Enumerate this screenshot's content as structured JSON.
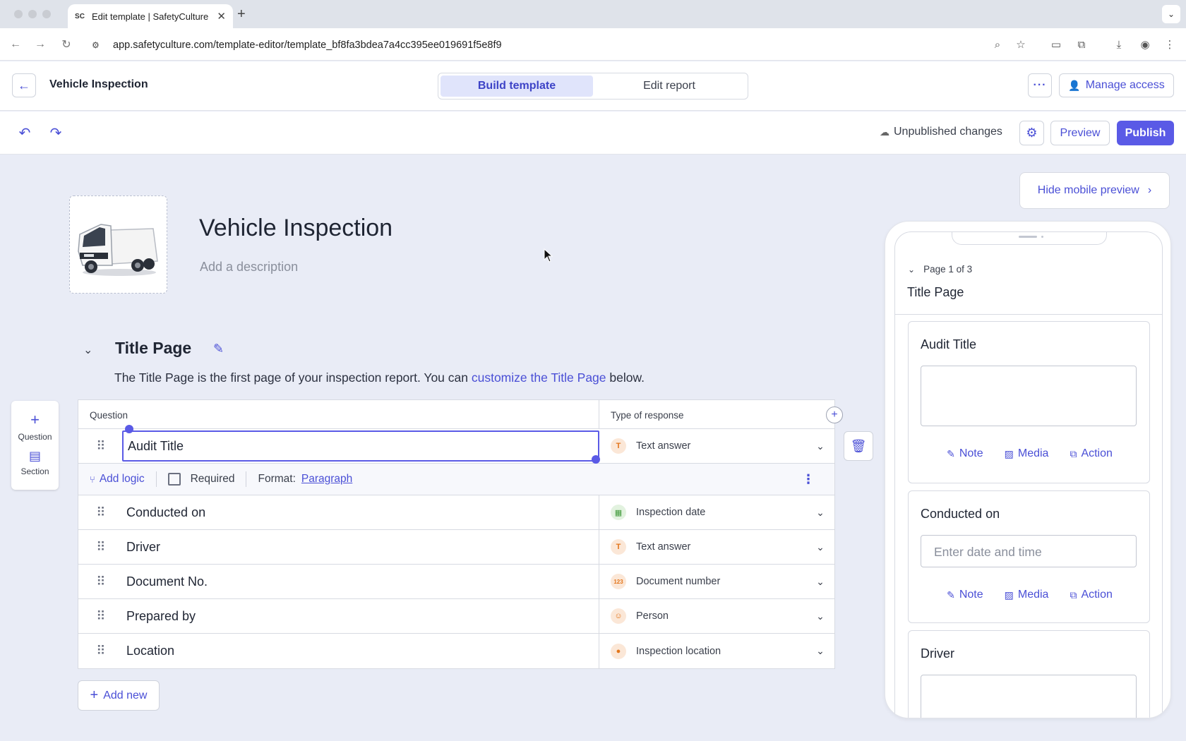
{
  "browser": {
    "tab_title": "Edit template | SafetyCulture",
    "url": "app.safetyculture.com/template-editor/template_bf8fa3bdea7a4cc395ee019691f5e8f9",
    "icons": [
      "back-arrow-icon",
      "forward-arrow-icon",
      "reload-icon",
      "site-settings-icon",
      "zoom-icon",
      "bookmark-star-icon",
      "cast-icon",
      "extensions-icon",
      "download-icon",
      "profile-icon",
      "menu-icon"
    ]
  },
  "header": {
    "doc_title": "Vehicle Inspection",
    "tabs": [
      {
        "label": "Build template",
        "active": true
      },
      {
        "label": "Edit report",
        "active": false
      }
    ],
    "manage_access": "Manage access"
  },
  "toolbar": {
    "status": "Unpublished changes",
    "preview": "Preview",
    "publish": "Publish"
  },
  "canvas": {
    "hide_preview": "Hide mobile preview",
    "title": "Vehicle Inspection",
    "description_placeholder": "Add a description",
    "section": {
      "title": "Title Page",
      "desc_before": "The Title Page is the first page of your inspection report. You can ",
      "desc_link": "customize the Title Page",
      "desc_after": " below."
    },
    "side_buttons": {
      "question": "Question",
      "section": "Section"
    },
    "table": {
      "col_question": "Question",
      "col_type": "Type of response",
      "rows": [
        {
          "question": "Audit Title",
          "type": "Text answer",
          "icon": "T",
          "selected": true
        },
        {
          "question": "Conducted on",
          "type": "Inspection date",
          "icon": "date-icon"
        },
        {
          "question": "Driver",
          "type": "Text answer",
          "icon": "T"
        },
        {
          "question": "Document No.",
          "type": "Document number",
          "icon": "123"
        },
        {
          "question": "Prepared by",
          "type": "Person",
          "icon": "person-icon"
        },
        {
          "question": "Location",
          "type": "Inspection location",
          "icon": "location-pin-icon"
        }
      ],
      "logic_row": {
        "add_logic": "Add logic",
        "required": "Required",
        "format_label": "Format:",
        "format_value": "Paragraph"
      }
    },
    "add_new": "Add new"
  },
  "mobile": {
    "page_indicator": "Page 1 of 3",
    "page_title": "Title Page",
    "cards": [
      {
        "label": "Audit Title",
        "kind": "textarea"
      },
      {
        "label": "Conducted on",
        "kind": "input",
        "placeholder": "Enter date and time"
      },
      {
        "label": "Driver",
        "kind": "textarea"
      }
    ],
    "actions": {
      "note": "Note",
      "media": "Media",
      "action": "Action"
    }
  },
  "colors": {
    "accent": "#5a5ae6",
    "link": "#4a4fd6",
    "canvas_bg": "#e9ecf6",
    "response_icon": "#e3761c"
  }
}
